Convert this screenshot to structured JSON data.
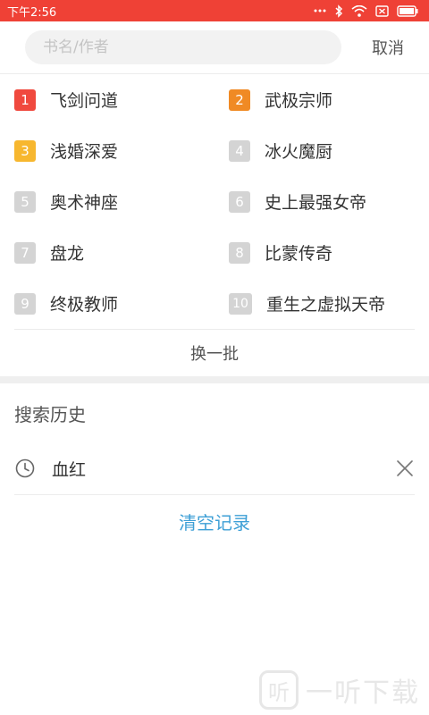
{
  "status_bar": {
    "time": "下午2:56",
    "icons": [
      "more-icon",
      "bluetooth-icon",
      "wifi-icon",
      "sim-icon",
      "battery-icon"
    ],
    "background": "#ef4136"
  },
  "search": {
    "placeholder": "书名/作者",
    "cancel_label": "取消"
  },
  "hot_list": [
    {
      "rank": "1",
      "title": "飞剑问道"
    },
    {
      "rank": "2",
      "title": "武极宗师"
    },
    {
      "rank": "3",
      "title": "浅婚深爱"
    },
    {
      "rank": "4",
      "title": "冰火魔厨"
    },
    {
      "rank": "5",
      "title": "奥术神座"
    },
    {
      "rank": "6",
      "title": "史上最强女帝"
    },
    {
      "rank": "7",
      "title": "盘龙"
    },
    {
      "rank": "8",
      "title": "比蒙传奇"
    },
    {
      "rank": "9",
      "title": "终极教师"
    },
    {
      "rank": "10",
      "title": "重生之虚拟天帝"
    }
  ],
  "rank_colors": {
    "1": "#f0493e",
    "2": "#f08a24",
    "3": "#f7b72f",
    "other": "#d4d4d4"
  },
  "refresh_label": "换一批",
  "history": {
    "title": "搜索历史",
    "items": [
      {
        "text": "血红"
      }
    ],
    "clear_label": "清空记录",
    "clear_color": "#3d9fd6"
  },
  "watermark": {
    "logo_char": "听",
    "text": "一听下载"
  }
}
